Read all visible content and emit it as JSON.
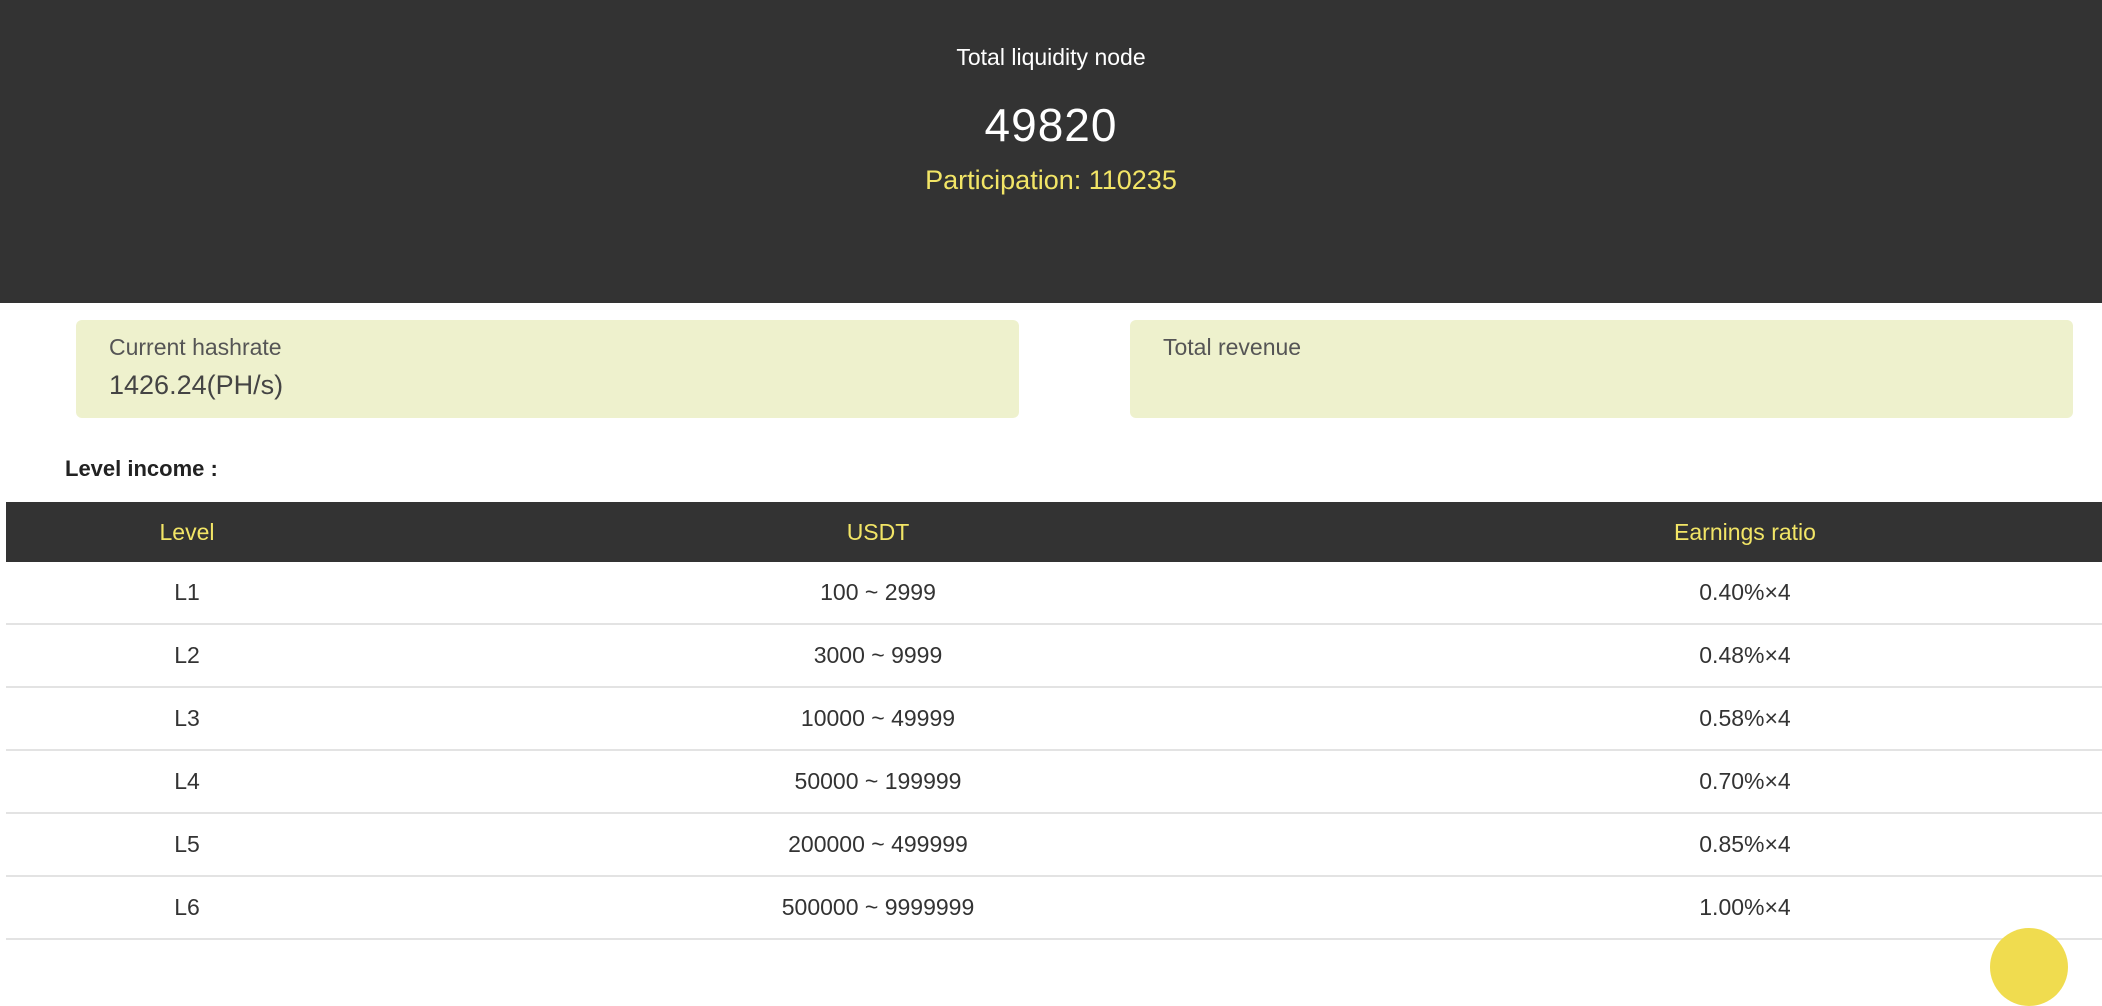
{
  "hero": {
    "title": "Total liquidity node",
    "value": "49820",
    "participation": "Participation: 110235"
  },
  "cards": {
    "hashrate_label": "Current hashrate",
    "hashrate_value": "1426.24(PH/s)",
    "revenue_label": "Total revenue",
    "revenue_value": ""
  },
  "level_income": {
    "title": "Level income :",
    "headers": [
      "Level",
      "USDT",
      "Earnings ratio"
    ],
    "rows": [
      [
        "L1",
        "100 ~ 2999",
        "0.40%×4"
      ],
      [
        "L2",
        "3000 ~ 9999",
        "0.48%×4"
      ],
      [
        "L3",
        "10000 ~ 49999",
        "0.58%×4"
      ],
      [
        "L4",
        "50000 ~ 199999",
        "0.70%×4"
      ],
      [
        "L5",
        "200000 ~ 499999",
        "0.85%×4"
      ],
      [
        "L6",
        "500000 ~ 9999999",
        "1.00%×4"
      ]
    ]
  },
  "colors": {
    "dark_bg": "#333333",
    "accent_yellow": "#f2e566",
    "card_bg": "#eef1cd"
  }
}
